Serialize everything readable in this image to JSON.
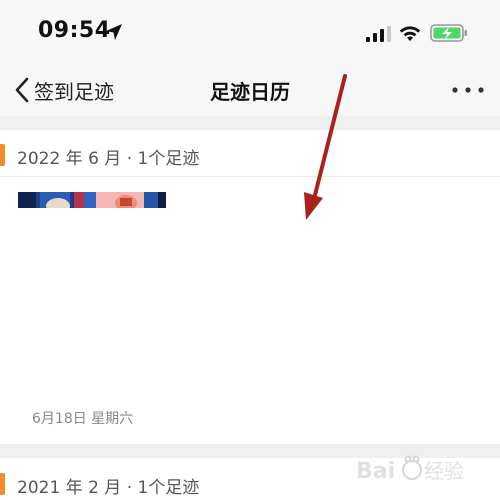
{
  "status_bar": {
    "time": "09:54",
    "icons": [
      "location-arrow-icon",
      "cellular-signal-icon",
      "wifi-icon",
      "battery-charging-icon"
    ]
  },
  "nav": {
    "back_label": "签到足迹",
    "title": "足迹日历",
    "more_icon": "more-dots-icon"
  },
  "sections": [
    {
      "header": "2022 年 6 月 · 1个足迹",
      "entries": [
        {
          "date": "6月18日 星期六"
        }
      ]
    },
    {
      "header": "2021 年 2 月 · 1个足迹"
    }
  ],
  "colors": {
    "accent": "#f28b2c",
    "annotation_arrow": "#a8231e",
    "background_gap": "#efefef",
    "bar_background": "#f7f7f7"
  },
  "watermark": {
    "text": "Baidu 经验"
  }
}
